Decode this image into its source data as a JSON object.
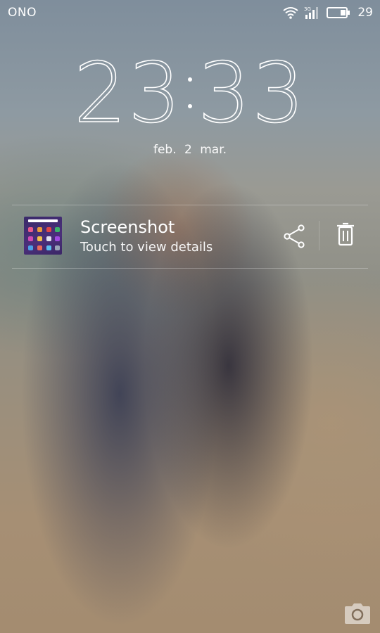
{
  "status_bar": {
    "carrier": "ONO",
    "network_label": "3G",
    "battery_percent": "29",
    "battery_level": 0.29,
    "icons": [
      "wifi-icon",
      "signal-icon",
      "battery-icon"
    ]
  },
  "lock_screen": {
    "time_hours": "23",
    "time_minutes": "33",
    "date_month": "feb.",
    "date_day": "2",
    "date_weekday": "mar."
  },
  "notification": {
    "title": "Screenshot",
    "subtitle": "Touch to view details",
    "actions": [
      "share-icon",
      "trash-icon"
    ]
  },
  "camera_shortcut": {
    "icon": "camera-icon"
  }
}
